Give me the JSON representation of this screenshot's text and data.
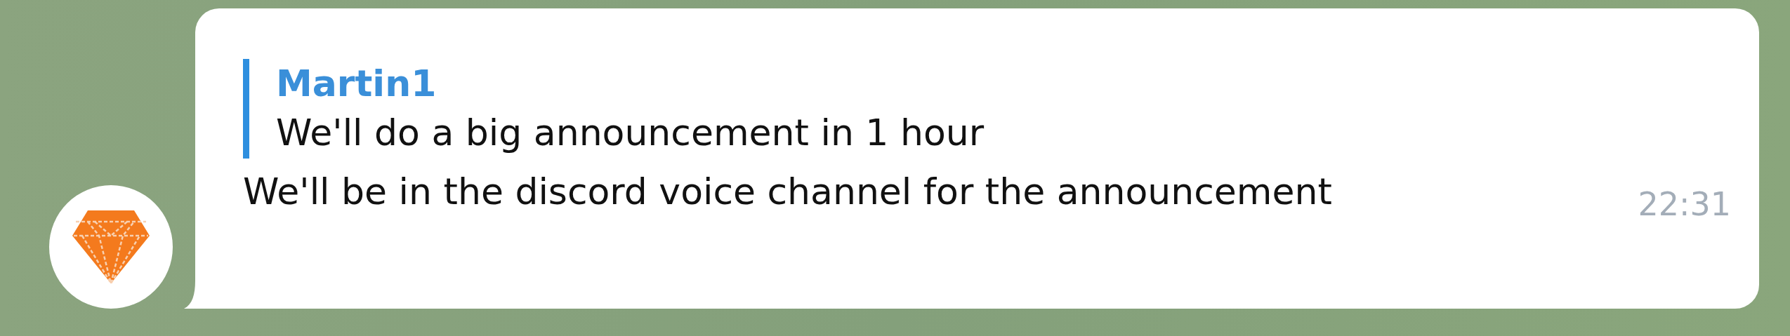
{
  "message": {
    "reply": {
      "author": "Martin1",
      "text": "We'll do a big announcement in 1 hour"
    },
    "text": "We'll be in the discord voice channel for the announcement",
    "time": "22:31"
  }
}
